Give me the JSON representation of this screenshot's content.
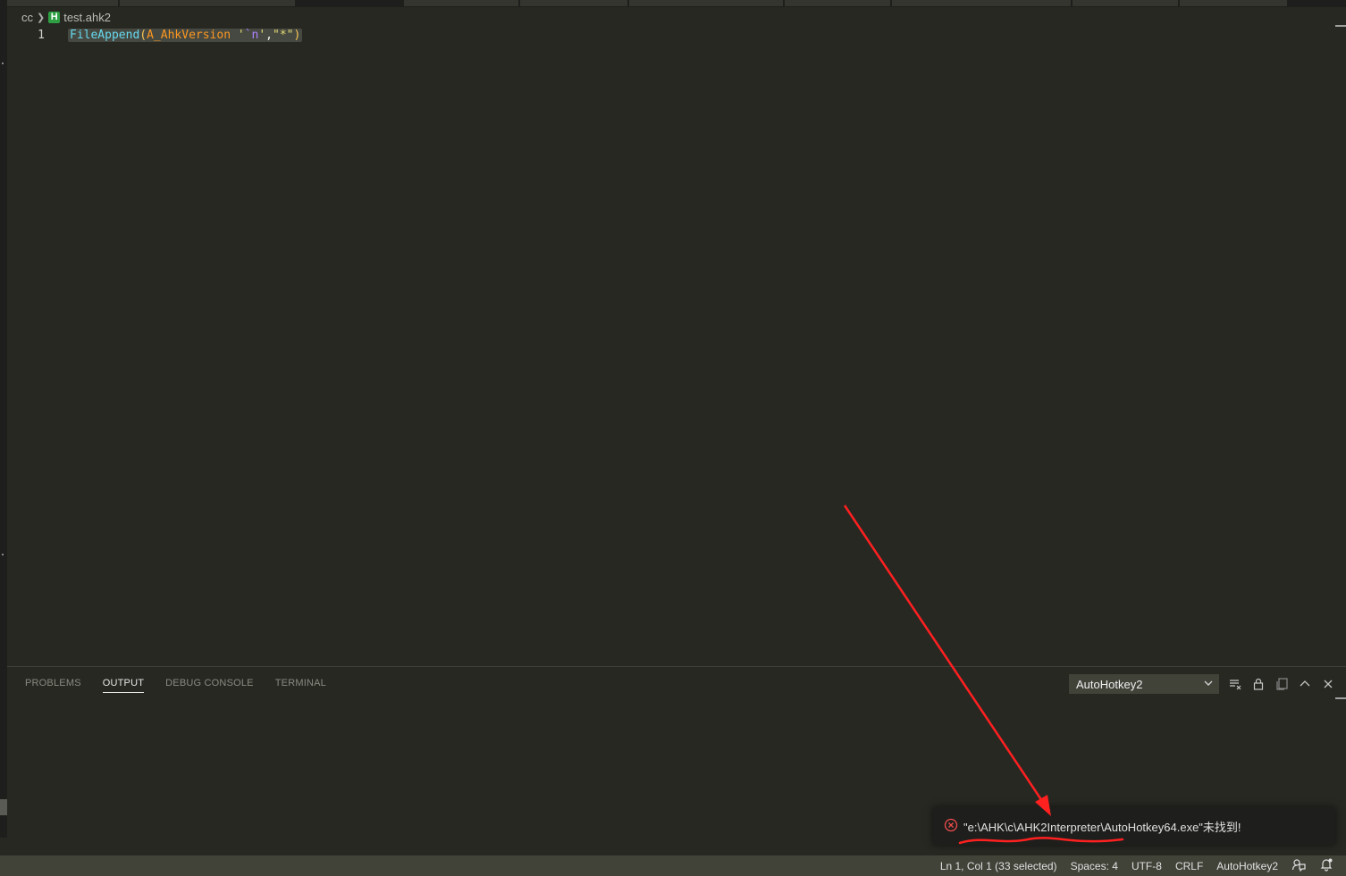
{
  "breadcrumb": {
    "folder": "cc",
    "file_icon": "H",
    "file": "test.ahk2"
  },
  "editor": {
    "line_number": "1",
    "code_tokens": {
      "fn": "FileAppend",
      "open_paren": "(",
      "var": "A_AhkVersion",
      "space": " ",
      "str1_open": "'",
      "escape": "`n",
      "str1_close": "'",
      "comma": ",",
      "str2": "\"*\"",
      "close_paren": ")"
    },
    "selected_text": "FileAppend(A_AhkVersion '`n',\"*\")"
  },
  "panel": {
    "tabs": [
      "PROBLEMS",
      "OUTPUT",
      "DEBUG CONSOLE",
      "TERMINAL"
    ],
    "active_tab": "OUTPUT",
    "output_channel": "AutoHotkey2",
    "icons": [
      "clear-output-icon",
      "lock-icon",
      "copy-icon",
      "maximize-panel-icon",
      "close-panel-icon"
    ]
  },
  "notification": {
    "icon": "error-icon",
    "message": "\"e:\\AHK\\c\\AHK2Interpreter\\AutoHotkey64.exe\"未找到!",
    "color": "#f14c4c"
  },
  "statusbar": {
    "position": "Ln 1, Col 1 (33 selected)",
    "indent": "Spaces: 4",
    "encoding": "UTF-8",
    "eol": "CRLF",
    "language": "AutoHotkey2",
    "icons": [
      "feedback-icon",
      "notifications-icon"
    ]
  },
  "colors": {
    "editor_bg": "#272822",
    "selection": "#464941",
    "annotation": "#ff2020"
  }
}
